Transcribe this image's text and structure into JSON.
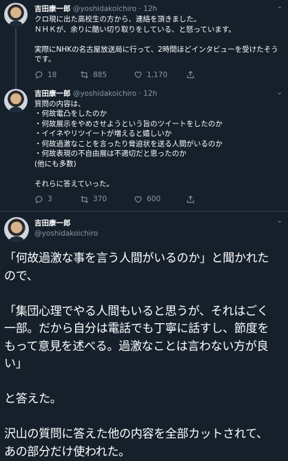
{
  "tweet1": {
    "name": "吉田康一郎",
    "handle": "@yoshidakoichiro",
    "dot": "·",
    "time": "12h",
    "text": "クロ現に出た高校生の方から、連絡を頂きました。\nＮＨＫが、余りに酷い切り取りをしている、と怒っています。\n\n実際にNHKの名古屋放送局に行って、2時間ほどインタビューを受けたそうです。",
    "replies": "18",
    "retweets": "885",
    "likes": "1,170"
  },
  "tweet2": {
    "name": "吉田康一郎",
    "handle": "@yoshidakoichiro",
    "dot": "·",
    "time": "12h",
    "text": "質問の内容は、\n・何故電凸をしたのか\n・何故展示をやめさせようという旨のツイートをしたのか\n・イイネやリツイートが増えると嬉しいか\n・何故過激なことを言ったり脅迫状を送る人間がいるのか\n・何故表現の不自由展は不適切だと思ったのか\n(他にも多数)\n\nそれらに答えていった。",
    "replies": "3",
    "retweets": "370",
    "likes": "600"
  },
  "main": {
    "name": "吉田康一郎",
    "handle": "@yoshidakoichiro",
    "text": "「何故過激な事を言う人間がいるのか」と聞かれたので、\n\n「集団心理でやる人間もいると思うが、それはごく一部。だから自分は電話でも丁寧に話すし、節度をもって意見を述べる。過激なことは言わない方が良い」\n\nと答えた。\n\n沢山の質問に答えた他の内容を全部カットされて、あの部分だけ使われた。"
  },
  "icons": [
    "reply-icon",
    "retweet-icon",
    "like-icon",
    "share-icon",
    "chevron-down-icon"
  ],
  "colors": {
    "background": "#15202b",
    "secondary_text": "#8899a6",
    "divider": "#38444d"
  }
}
